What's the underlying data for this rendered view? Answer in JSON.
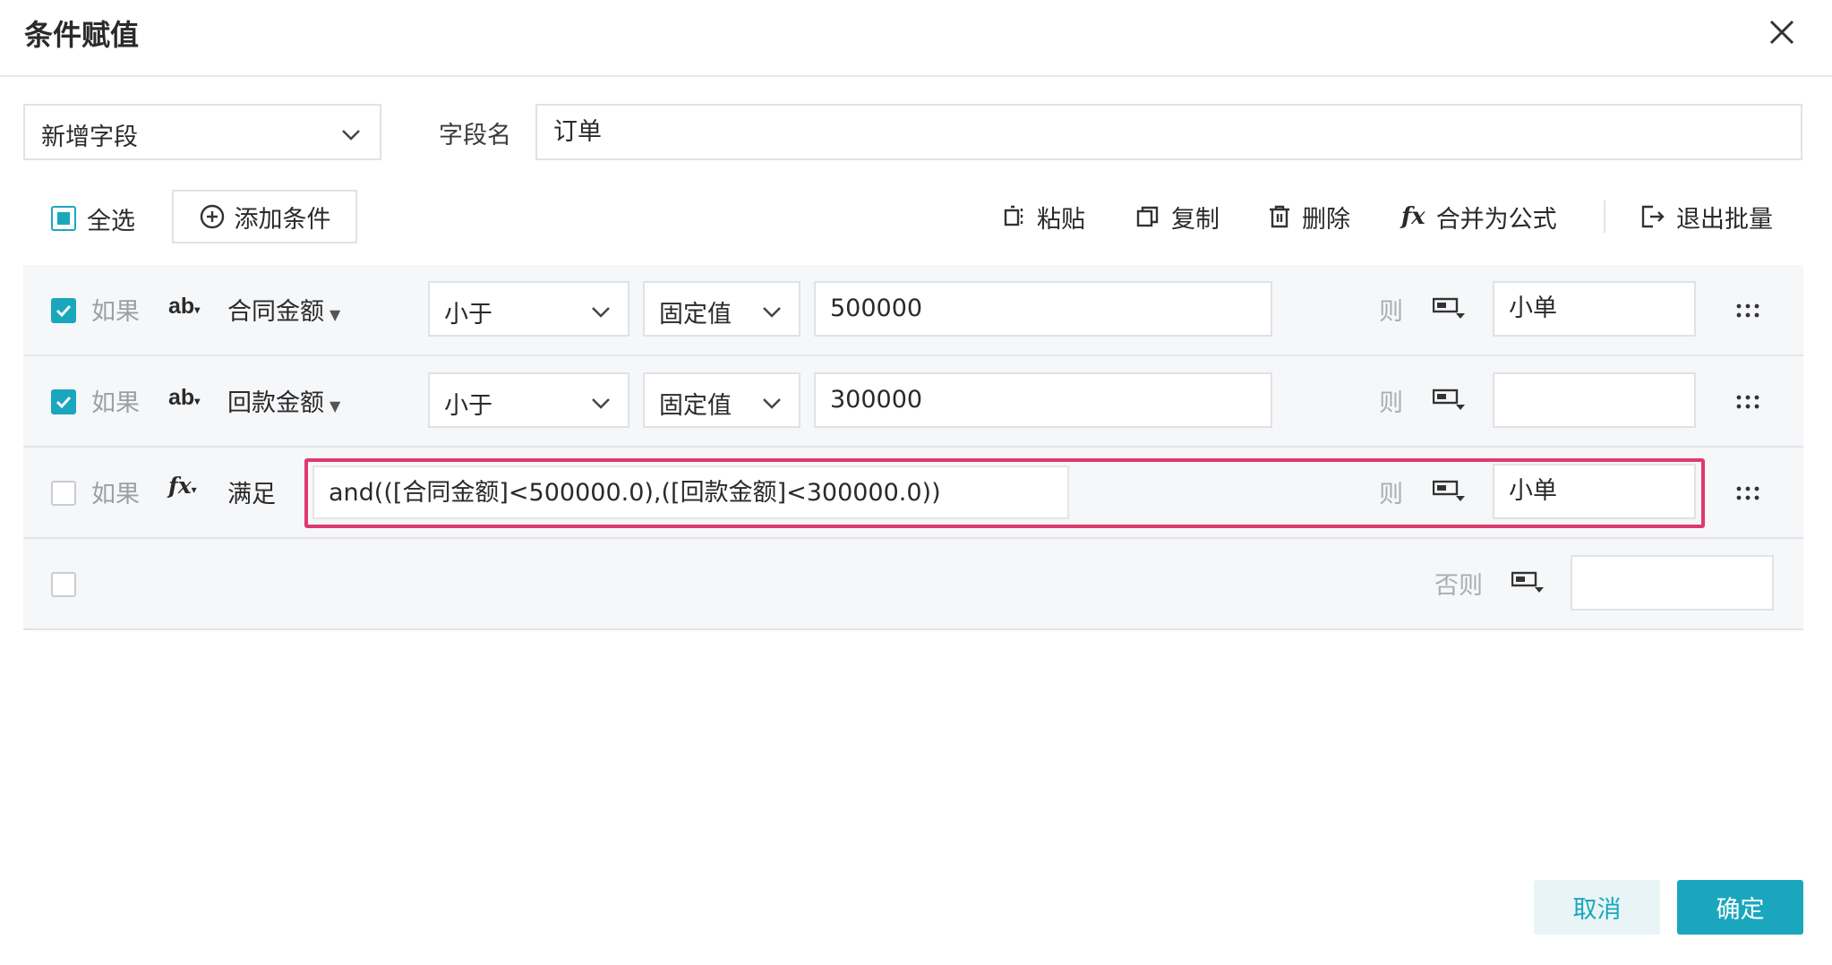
{
  "dialog": {
    "title": "条件赋值",
    "close_icon": "close-icon"
  },
  "field": {
    "mode_select_value": "新增字段",
    "name_label": "字段名",
    "name_value": "订单"
  },
  "toolbar": {
    "select_all_label": "全选",
    "add_condition_label": "添加条件",
    "paste_label": "粘贴",
    "copy_label": "复制",
    "delete_label": "删除",
    "merge_formula_label": "合并为公式",
    "exit_batch_label": "退出批量"
  },
  "rules": [
    {
      "checked": true,
      "if_label": "如果",
      "type_icon": "ab",
      "field": "合同金额",
      "operator": "小于",
      "value_mode": "固定值",
      "value": "500000",
      "then_label": "则",
      "result": "小单"
    },
    {
      "checked": true,
      "if_label": "如果",
      "type_icon": "ab",
      "field": "回款金额",
      "operator": "小于",
      "value_mode": "固定值",
      "value": "300000",
      "then_label": "则",
      "result": ""
    },
    {
      "checked": false,
      "if_label": "如果",
      "type_icon": "fx",
      "field": "满足",
      "formula": "and(([合同金额]<500000.0),([回款金额]<300000.0))",
      "then_label": "则",
      "result": "小单"
    }
  ],
  "else_row": {
    "checked": false,
    "else_label": "否则",
    "result": ""
  },
  "footer": {
    "cancel_label": "取消",
    "ok_label": "确定"
  },
  "colors": {
    "accent": "#1aa7bd",
    "highlight_border": "#e0396d"
  }
}
